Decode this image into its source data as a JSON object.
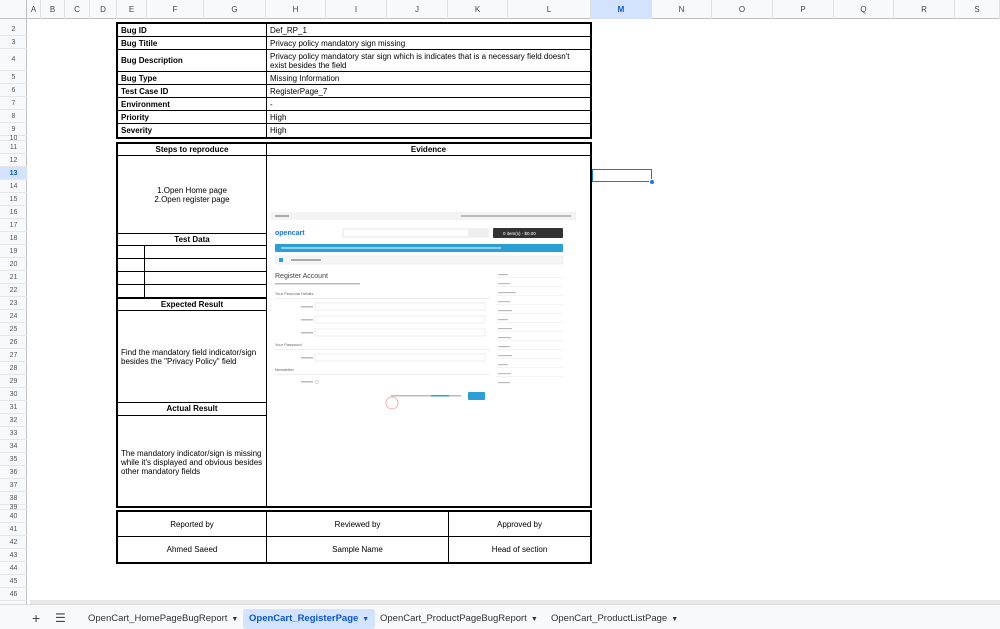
{
  "columns": [
    "A",
    "B",
    "C",
    "D",
    "E",
    "F",
    "G",
    "H",
    "I",
    "J",
    "K",
    "L",
    "M",
    "N",
    "O",
    "P",
    "Q",
    "R",
    "S"
  ],
  "rows": [
    "2",
    "3",
    "4",
    "5",
    "6",
    "7",
    "8",
    "9",
    "10",
    "11",
    "12",
    "13",
    "14",
    "15",
    "16",
    "17",
    "18",
    "19",
    "20",
    "21",
    "22",
    "23",
    "24",
    "25",
    "26",
    "27",
    "28",
    "29",
    "30",
    "31",
    "32",
    "33",
    "34",
    "35",
    "36",
    "37",
    "38",
    "39",
    "40",
    "41",
    "42",
    "43",
    "44",
    "45",
    "46"
  ],
  "selected_column": "M",
  "selected_row": "13",
  "bug": [
    {
      "key": "Bug ID",
      "value": "Def_RP_1"
    },
    {
      "key": "Bug Titile",
      "value": "Privacy policy mandatory sign missing"
    },
    {
      "key": "Bug Description",
      "value": "Privacy policy mandatory star sign which is indicates that is a necessary field doesn't exist besides the field"
    },
    {
      "key": "Bug Type",
      "value": "Missing Information"
    },
    {
      "key": "Test Case ID",
      "value": "RegisterPage_7"
    },
    {
      "key": "Environment",
      "value": "-"
    },
    {
      "key": "Priority",
      "value": "High"
    },
    {
      "key": "Severity",
      "value": "High"
    }
  ],
  "steps_header": "Steps to reproduce",
  "evidence_header": "Evidence",
  "steps": [
    "1.Open Home page",
    "2.Open register page"
  ],
  "test_data_header": "Test Data",
  "expected_header": "Expected Result",
  "expected_text": "Find the mandatory field indicator/sign besides the \"Privacy Policy\" field",
  "actual_header": "Actual Result",
  "actual_text": "The mandatory indicator/sign is missing while it's displayed and obvious besides other mandatory fields",
  "signoff": {
    "reported_by_label": "Reported by",
    "reviewed_by_label": "Reviewed by",
    "approved_by_label": "Approved by",
    "reported_by": "Ahmed Saeed",
    "reviewed_by": "Sample Name",
    "approved_by": "Head of section"
  },
  "evidence_shot": {
    "logo": "opencart",
    "cart": "0 item(s) - $0.00",
    "heading": "Register Account",
    "section1": "Your Personal Details",
    "section2": "Your Password",
    "section3": "Newsletter",
    "button": "Continue"
  },
  "tabs": [
    {
      "label": "OpenCart_HomePageBugReport",
      "active": false
    },
    {
      "label": "OpenCart_RegisterPage",
      "active": true
    },
    {
      "label": "OpenCart_ProductPageBugReport",
      "active": false
    },
    {
      "label": "OpenCart_ProductListPage",
      "active": false
    }
  ],
  "icons": {
    "add": "plus-icon",
    "menu": "hamburger-icon"
  },
  "accent": "#1a73e8"
}
